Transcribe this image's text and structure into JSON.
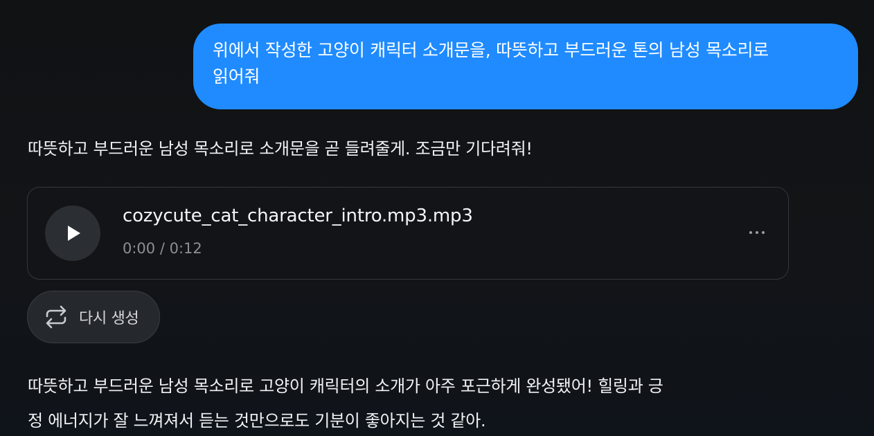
{
  "user_message": {
    "text": "위에서 작성한 고양이 캐릭터 소개문을, 따뜻하고 부드러운 톤의 남성 목소리로\n읽어줘",
    "bubble_color": "#1f8bff"
  },
  "assistant": {
    "intro": "따뜻하고 부드러운 남성 목소리로 소개문을 곧 들려줄게. 조금만 기다려줘!",
    "audio": {
      "file_name": "cozycute_cat_character_intro.mp3.mp3",
      "time_display": "0:00 / 0:12",
      "play_icon": "play-icon",
      "more_icon": "more-icon"
    },
    "regenerate": {
      "label": "다시 생성",
      "icon": "repeat-icon"
    },
    "closing_line1": "따뜻하고 부드러운 남성 목소리로 고양이 캐릭터의 소개가 아주 포근하게 완성됐어! 힐링과 긍",
    "closing_line2": "정 에너지가 잘 느껴져서 듣는 것만으로도 기분이 좋아지는 것 같아."
  }
}
